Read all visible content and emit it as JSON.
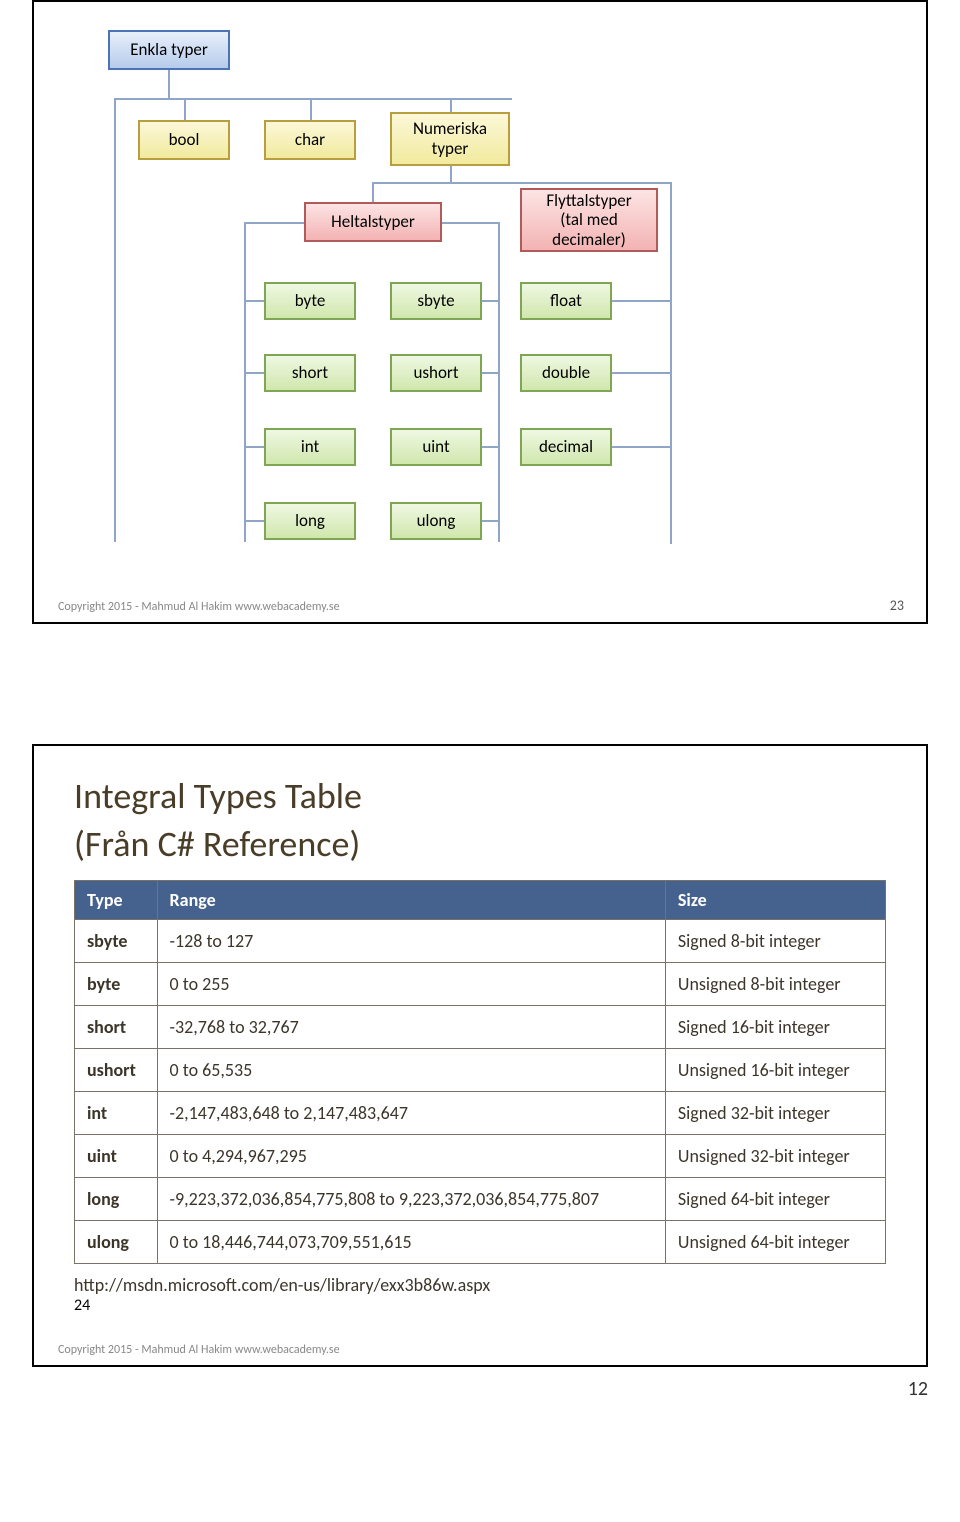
{
  "diagram": {
    "root": "Enkla typer",
    "bool": "bool",
    "char": "char",
    "numeric": "Numeriska\ntyper",
    "intTypes": "Heltalstyper",
    "floatTypes": "Flyttalstyper\n(tal med\ndecimaler)",
    "byte": "byte",
    "sbyte": "sbyte",
    "float": "float",
    "short": "short",
    "ushort": "ushort",
    "double": "double",
    "int": "int",
    "uint": "uint",
    "decimal": "decimal",
    "long": "long",
    "ulong": "ulong"
  },
  "slide1": {
    "copyright": "Copyright 2015 - Mahmud Al Hakim www.webacademy.se",
    "pageNumber": "23"
  },
  "table": {
    "title": "Integral Types Table",
    "subtitle": "(Från C# Reference)",
    "headers": {
      "type": "Type",
      "range": "Range",
      "size": "Size"
    },
    "rows": [
      {
        "type": "sbyte",
        "range": "-128 to 127",
        "size": "Signed 8-bit integer"
      },
      {
        "type": "byte",
        "range": "0 to 255",
        "size": "Unsigned 8-bit integer"
      },
      {
        "type": "short",
        "range": "-32,768 to 32,767",
        "size": "Signed 16-bit integer"
      },
      {
        "type": "ushort",
        "range": "0 to 65,535",
        "size": "Unsigned 16-bit integer"
      },
      {
        "type": "int",
        "range": "-2,147,483,648 to 2,147,483,647",
        "size": "Signed 32-bit integer"
      },
      {
        "type": "uint",
        "range": "0 to 4,294,967,295",
        "size": "Unsigned 32-bit integer"
      },
      {
        "type": "long",
        "range": "-9,223,372,036,854,775,808 to 9,223,372,036,854,775,807",
        "size": "Signed 64-bit integer"
      },
      {
        "type": "ulong",
        "range": "0 to 18,446,744,073,709,551,615",
        "size": "Unsigned 64-bit integer"
      }
    ],
    "url": "http://msdn.microsoft.com/en-us/library/exx3b86w.aspx",
    "copyright": "Copyright 2015 - Mahmud Al Hakim www.webacademy.se",
    "pageNumber": "24"
  },
  "doc": {
    "pageNumber": "12"
  }
}
